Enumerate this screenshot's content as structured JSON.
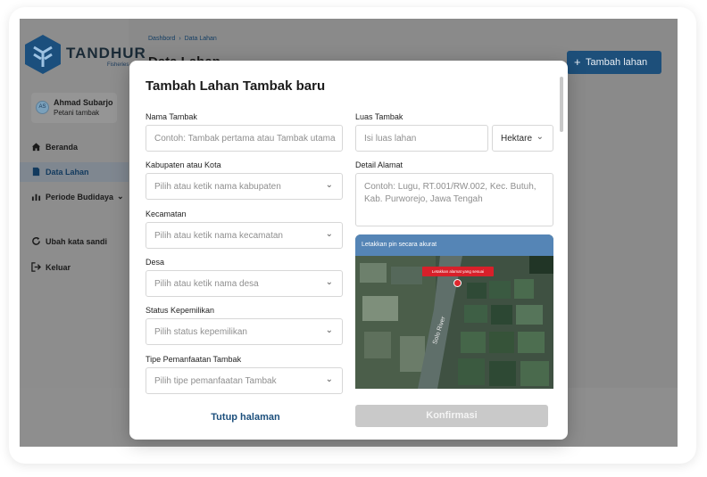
{
  "brand": {
    "name": "TANDHUR",
    "sub": "Fisheries"
  },
  "user": {
    "initials": "AS",
    "name": "Ahmad Subarjo",
    "role": "Petani tambak"
  },
  "sidebar": {
    "items": [
      {
        "label": "Beranda",
        "icon": "home-icon"
      },
      {
        "label": "Data Lahan",
        "icon": "document-icon"
      },
      {
        "label": "Periode Budidaya",
        "icon": "chart-icon"
      },
      {
        "label": "Ubah kata sandi",
        "icon": "refresh-icon"
      },
      {
        "label": "Keluar",
        "icon": "logout-icon"
      }
    ]
  },
  "breadcrumb": {
    "items": [
      "Dashbord",
      "›",
      "Data Lahan"
    ]
  },
  "page": {
    "title": "Data Lahan",
    "add_button": "Tambah lahan"
  },
  "modal": {
    "title": "Tambah Lahan Tambak baru",
    "fields": {
      "nama_label": "Nama Tambak",
      "nama_placeholder": "Contoh: Tambak pertama atau Tambak utama",
      "luas_label": "Luas Tambak",
      "luas_placeholder": "Isi luas lahan",
      "unit_value": "Hektare",
      "kabupaten_label": "Kabupaten atau Kota",
      "kabupaten_placeholder": "Pilih atau ketik nama kabupaten",
      "alamat_label": "Detail Alamat",
      "alamat_placeholder": "Contoh: Lugu, RT.001/RW.002, Kec. Butuh, Kab. Purworejo, Jawa Tengah",
      "kecamatan_label": "Kecamatan",
      "kecamatan_placeholder": "Pilih atau ketik nama kecamatan",
      "desa_label": "Desa",
      "desa_placeholder": "Pilih atau ketik nama desa",
      "status_label": "Status Kepemilikan",
      "status_placeholder": "Pilih status kepemilikan",
      "tipe_label": "Tipe Pemanfaatan Tambak",
      "tipe_placeholder": "Pilih tipe pemanfaatan Tambak"
    },
    "map": {
      "header": "Letakkan pin secara akurat",
      "pin_label": "Letakkan alamat yang sesuai",
      "river_label": "Solo River"
    },
    "close_button": "Tutup halaman",
    "confirm_button": "Konfirmasi"
  },
  "colors": {
    "primary": "#1d4f7a",
    "map_header": "#5585b6",
    "pin": "#d8202a"
  }
}
